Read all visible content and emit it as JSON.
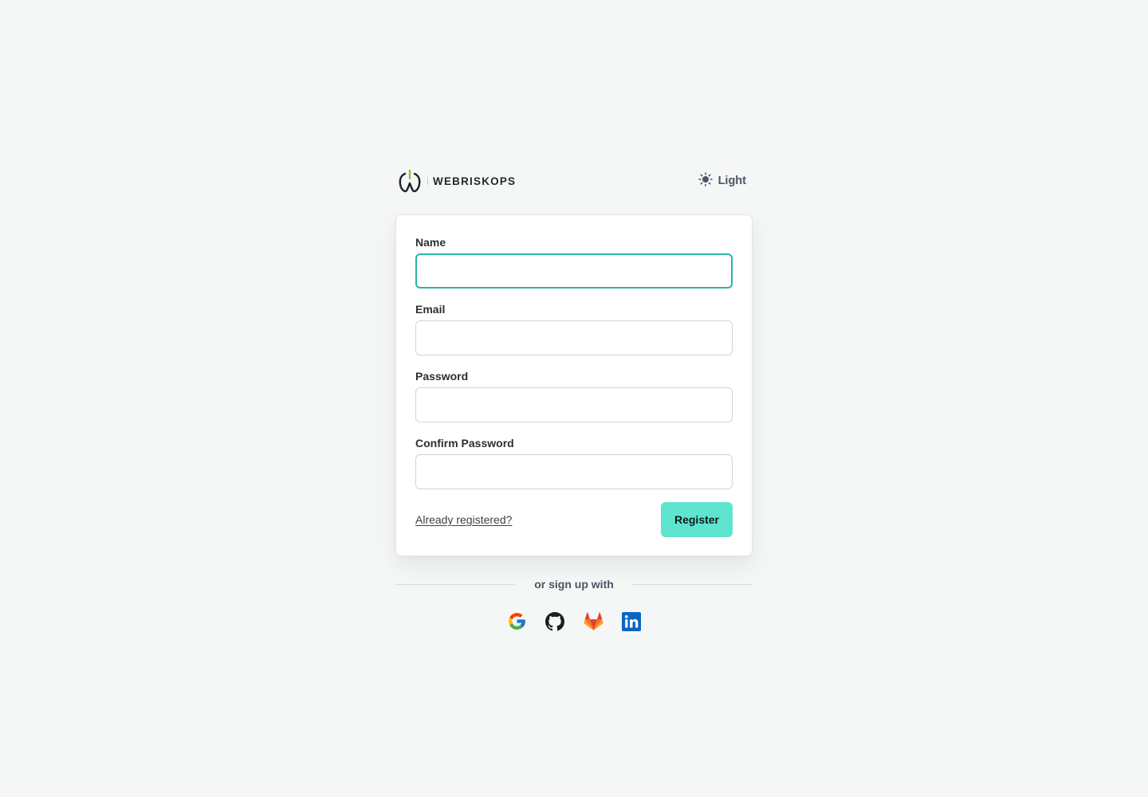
{
  "brand": {
    "name": "WEBRISKOPS"
  },
  "theme_toggle": {
    "label": "Light",
    "icon": "sun-icon"
  },
  "form": {
    "fields": [
      {
        "label": "Name",
        "value": "",
        "type": "text"
      },
      {
        "label": "Email",
        "value": "",
        "type": "email"
      },
      {
        "label": "Password",
        "value": "",
        "type": "password"
      },
      {
        "label": "Confirm Password",
        "value": "",
        "type": "password"
      }
    ],
    "login_link": "Already registered?",
    "submit_label": "Register"
  },
  "social": {
    "divider_text": "or sign up with",
    "providers": [
      {
        "name": "Google",
        "icon": "google-icon"
      },
      {
        "name": "GitHub",
        "icon": "github-icon"
      },
      {
        "name": "GitLab",
        "icon": "gitlab-icon"
      },
      {
        "name": "LinkedIn",
        "icon": "linkedin-icon"
      }
    ]
  },
  "colors": {
    "accent": "#5ee4cf",
    "focus_border": "#2ab3a6",
    "background": "#f5f7f6"
  }
}
